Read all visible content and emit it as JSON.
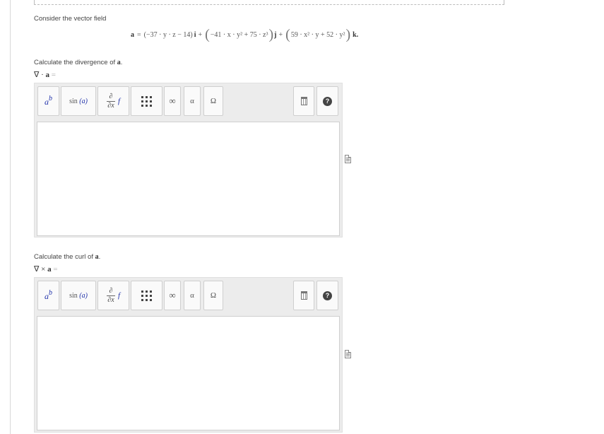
{
  "intro": "Consider the vector field",
  "formula": {
    "lhs": "a",
    "eq": " = ",
    "t1": "(−37 · y · z − 14)",
    "i": "i",
    "plus1": " + ",
    "t2": "−41 · x · y² + 75 · z³",
    "j": "j",
    "plus2": " + ",
    "t3": "59 · x² · y + 52 · y²",
    "k": "k",
    "end": "."
  },
  "q1": {
    "prompt_start": "Calculate the divergence of ",
    "prompt_var": "a",
    "prompt_end": ".",
    "lhs_op": "∇ · ",
    "lhs_var": "a",
    "lhs_eq": " ="
  },
  "q2": {
    "prompt_start": "Calculate the curl of ",
    "prompt_var": "a",
    "prompt_end": ".",
    "lhs_op": "∇ × ",
    "lhs_var": "a",
    "lhs_eq": " ="
  },
  "toolbar": {
    "power_base": "a",
    "power_exp": "b",
    "sin_label": "sin ",
    "sin_arg": "(a)",
    "deriv_num": "∂",
    "deriv_den": "∂x",
    "deriv_f": "f",
    "inf": "∞",
    "alpha": "α",
    "omega": "Ω",
    "help": "?"
  },
  "icons": {
    "power": "power-icon",
    "sin": "sine-icon",
    "derivative": "partial-derivative-icon",
    "matrix": "matrix-icon",
    "infinity": "infinity-icon",
    "greek": "greek-letter-icon",
    "special": "symbol-icon",
    "trash": "trash-icon",
    "help": "help-icon",
    "document": "document-icon"
  }
}
